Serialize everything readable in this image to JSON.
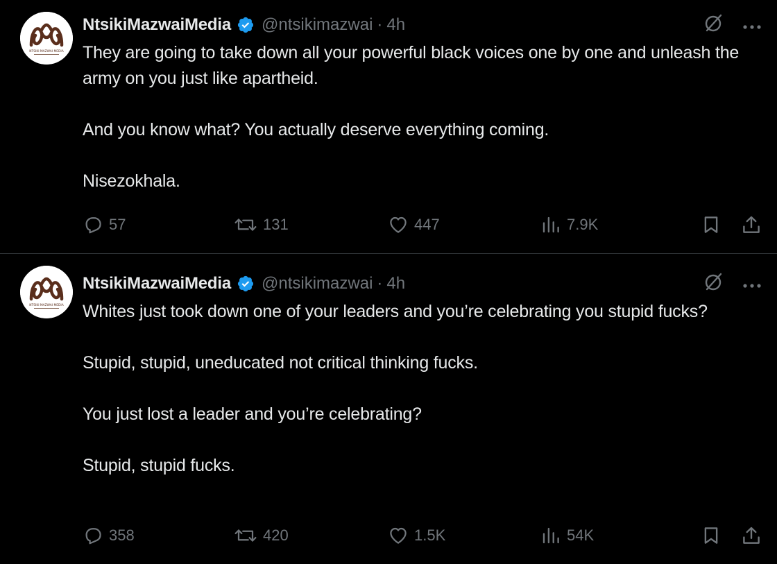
{
  "colors": {
    "background": "#000000",
    "text_primary": "#e7e9ea",
    "text_secondary": "#71767b",
    "verified_blue": "#1d9bf0",
    "divider": "#2f3336"
  },
  "tweets": [
    {
      "author": {
        "display_name": "NtsikiMazwaiMedia",
        "handle": "@ntsikimazwai",
        "verified_icon": "verified-badge-icon",
        "avatar_icon": "ntsiki-mazwai-media-logo",
        "avatar_logo_text": "NTSIKI MAZWAI MEDIA"
      },
      "separator": "·",
      "time": "4h",
      "paragraphs": [
        "They are going to take down all your powerful black voices one by one and unleash the army on you just like apartheid.",
        "And you know what? You actually deserve everything coming.",
        "Nisezokhala."
      ],
      "stats": {
        "replies": "57",
        "retweets": "131",
        "likes": "447",
        "views": "7.9K"
      }
    },
    {
      "author": {
        "display_name": "NtsikiMazwaiMedia",
        "handle": "@ntsikimazwai",
        "verified_icon": "verified-badge-icon",
        "avatar_icon": "ntsiki-mazwai-media-logo",
        "avatar_logo_text": "NTSIKI MAZWAI MEDIA"
      },
      "separator": "·",
      "time": "4h",
      "paragraphs": [
        "Whites just took down one of your leaders and you’re celebrating you stupid fucks?",
        "Stupid, stupid, uneducated not critical thinking fucks.",
        "You just lost a leader and you’re celebrating?",
        "Stupid, stupid fucks."
      ],
      "stats": {
        "replies": "358",
        "retweets": "420",
        "likes": "1.5K",
        "views": "54K"
      }
    }
  ]
}
